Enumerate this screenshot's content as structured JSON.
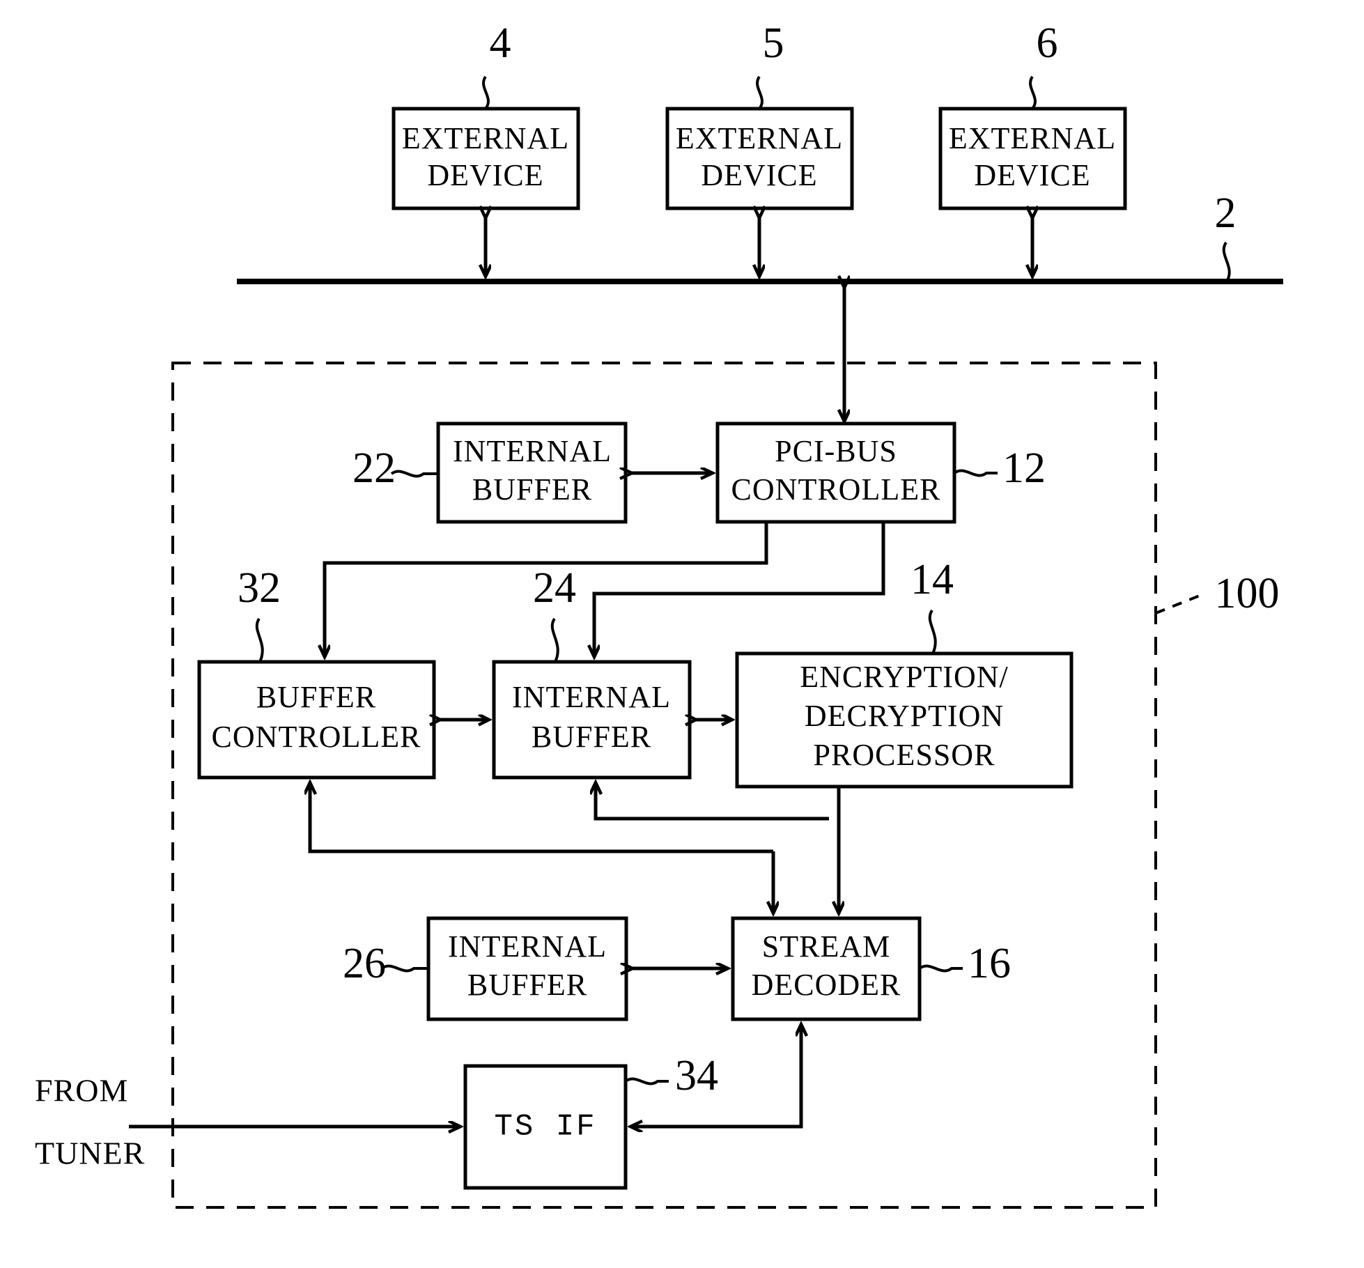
{
  "figure": {
    "kind": "patent-block-diagram",
    "background": "#ffffff",
    "stroke": "#000000"
  },
  "blocks": {
    "external_device_1": {
      "line1": "EXTERNAL",
      "line2": "DEVICE",
      "ref": "4"
    },
    "external_device_2": {
      "line1": "EXTERNAL",
      "line2": "DEVICE",
      "ref": "5"
    },
    "external_device_3": {
      "line1": "EXTERNAL",
      "line2": "DEVICE",
      "ref": "6"
    },
    "internal_buffer_22": {
      "line1": "INTERNAL",
      "line2": "BUFFER",
      "ref": "22"
    },
    "pci_bus_controller": {
      "line1": "PCI-BUS",
      "line2": "CONTROLLER",
      "ref": "12"
    },
    "buffer_controller": {
      "line1": "BUFFER",
      "line2": "CONTROLLER",
      "ref": "32"
    },
    "internal_buffer_24": {
      "line1": "INTERNAL",
      "line2": "BUFFER",
      "ref": "24"
    },
    "encryption_processor": {
      "line1": "ENCRYPTION/",
      "line2": "DECRYPTION",
      "line3": "PROCESSOR",
      "ref": "14"
    },
    "internal_buffer_26": {
      "line1": "INTERNAL",
      "line2": "BUFFER",
      "ref": "26"
    },
    "stream_decoder": {
      "line1": "STREAM",
      "line2": "DECODER",
      "ref": "16"
    },
    "ts_if": {
      "line1": "TS IF",
      "ref": "34"
    }
  },
  "labels": {
    "bus_ref": "2",
    "chip_ref": "100",
    "from_tuner_line1": "FROM",
    "from_tuner_line2": "TUNER"
  }
}
